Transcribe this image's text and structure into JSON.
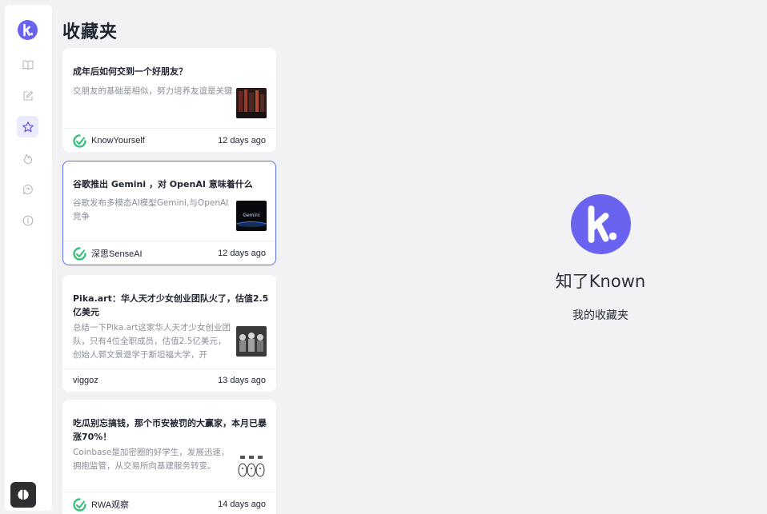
{
  "app": {
    "name": "知了Known",
    "subtitle": "我的收藏夹",
    "accent": "#6a63f0"
  },
  "page": {
    "title": "收藏夹"
  },
  "sidebar": {
    "items": [
      {
        "icon": "book-icon",
        "label": "阅读"
      },
      {
        "icon": "edit-icon",
        "label": "写作"
      },
      {
        "icon": "star-icon",
        "label": "收藏",
        "active": true
      },
      {
        "icon": "fire-icon",
        "label": "热门"
      },
      {
        "icon": "chat-icon",
        "label": "消息"
      },
      {
        "icon": "info-icon",
        "label": "关于"
      }
    ]
  },
  "articles": [
    {
      "title": "成年后如何交到一个好朋友？",
      "summary": "交朋友的基础是相似，努力培养友谊是关键",
      "source": "KnowYourself",
      "time": "12 days ago"
    },
    {
      "title": "谷歌推出 Gemini ，对 OpenAI 意味着什么",
      "summary": "谷歌发布多模态AI模型Gemini,与OpenAI竞争",
      "source": "深思SenseAI",
      "time": "12 days ago",
      "selected": true
    },
    {
      "title": "Pika.art：华人天才少女创业团队火了，估值2.5亿美元",
      "summary": "总结一下Pika.art这家华人天才少女创业团队，只有4位全职成员，估值2.5亿美元，创始人郭文景退学于斯坦福大学，开",
      "source": "viggoz",
      "time": "13 days ago"
    },
    {
      "title": "吃瓜别忘搞钱，那个币安被罚的大赢家，本月已暴涨70%！",
      "summary": "Coinbase是加密圈的好学生，发展迅速，拥抱监管，从交易所向基建服务转变。",
      "source": "RWA观察",
      "time": "14 days ago"
    }
  ]
}
